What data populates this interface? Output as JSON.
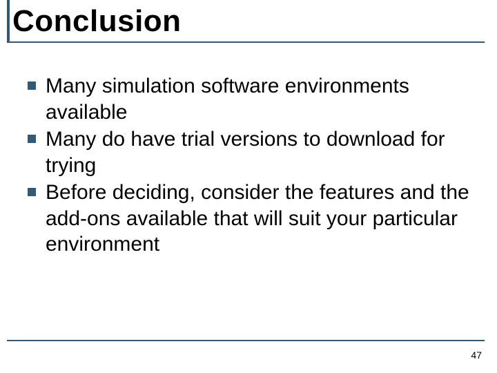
{
  "slide": {
    "title": "Conclusion",
    "bullets": [
      "Many simulation software environments available",
      "Many do have trial versions to download for trying",
      "Before deciding, consider the features and the add-ons available that will suit your particular environment"
    ],
    "page_number": "47"
  }
}
